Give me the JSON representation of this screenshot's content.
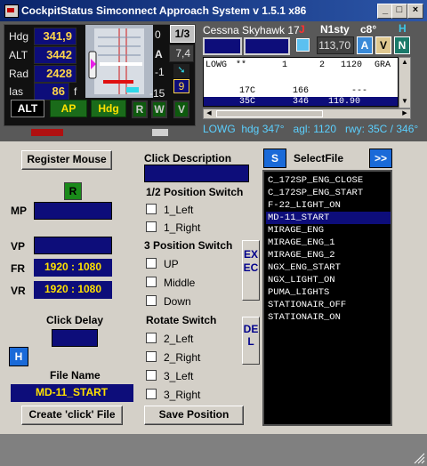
{
  "window": {
    "title": "CockpitStatus Simconnect Approach System v 1.5.1   x86",
    "minimize": "_",
    "maximize": "□",
    "close": "×"
  },
  "instruments": {
    "hdg_label": "Hdg",
    "hdg_value": "341,9",
    "alt_label": "ALT",
    "alt_value": "3442",
    "rad_label": "Rad",
    "rad_value": "2428",
    "ias_label": "Ias",
    "ias_value": "86",
    "ias_unit": "f",
    "btn_alt": "ALT",
    "btn_ap": "AP",
    "btn_hdg": "Hdg",
    "btn_r": "R",
    "btn_w": "W",
    "btn_v": "V"
  },
  "gauge": {
    "scale_top": "0",
    "scale_mid": "-1",
    "scale_bottom": "-15",
    "ratio": "1/3",
    "a_label": "A",
    "a_value": "7,4",
    "small_value": "9"
  },
  "aircraft": {
    "name": "Cessna Skyhawk 17",
    "j_label": "J",
    "n1_label": "N1sty",
    "temp_label": "c8°",
    "h_label": "H",
    "freq": "113,70",
    "btn_a": "A",
    "btn_v": "V",
    "btn_n": "N"
  },
  "approach_table": {
    "rows": [
      [
        "LOWG",
        "**",
        "1",
        "2",
        "1120",
        "GRA"
      ],
      [
        "",
        "",
        "",
        "",
        "",
        ""
      ],
      [
        "",
        "17C",
        "166",
        "---",
        "",
        ""
      ],
      [
        "",
        "35C",
        "346",
        "110.90",
        "",
        ""
      ]
    ],
    "status": "LOWG  hdg 347°   agl: 1120   rwy: 35C / 346°"
  },
  "left_panel": {
    "register_mouse": "Register Mouse",
    "r_button": "R",
    "mp_label": "MP",
    "vp_label": "VP",
    "fr_label": "FR",
    "fr_value": "1920 : 1080",
    "vr_label": "VR",
    "vr_value": "1920 : 1080",
    "click_delay": "Click Delay",
    "h_button": "H",
    "file_name_label": "File Name",
    "file_name_value": "MD-11_START",
    "create_file": "Create 'click' File"
  },
  "center_panel": {
    "click_description": "Click Description",
    "pos2_header": "1/2  Position Switch",
    "opt_1_left": "1_Left",
    "opt_1_right": "1_Right",
    "pos3_header": "3 Position Switch",
    "opt_up": "UP",
    "opt_middle": "Middle",
    "opt_down": "Down",
    "rotate_header": "Rotate Switch",
    "opt_2_left": "2_Left",
    "opt_2_right": "2_Right",
    "opt_3_left": "3_Left",
    "opt_3_right": "3_Right",
    "save_position": "Save  Position",
    "exec": "EXEC",
    "del": "DEL"
  },
  "right_panel": {
    "s_button": "S",
    "select_file": "SelectFile",
    "next_button": ">>",
    "files": [
      "C_172SP_ENG_CLOSE",
      "C_172SP_ENG_START",
      "F-22_LIGHT_ON",
      "MD-11_START",
      "MIRAGE_ENG",
      "MIRAGE_ENG_1",
      "MIRAGE_ENG_2",
      "NGX_ENG_START",
      "NGX_LIGHT_ON",
      "PUMA_LIGHTS",
      "STATIONAIR_OFF",
      "STATIONAIR_ON"
    ],
    "selected": "MD-11_START"
  },
  "colors": {
    "navy": "#0d0d7a",
    "yellow": "#ffd54a",
    "green": "#1a6b1a",
    "cyan": "#3cc8e8",
    "panel": "#d4d0c8"
  }
}
